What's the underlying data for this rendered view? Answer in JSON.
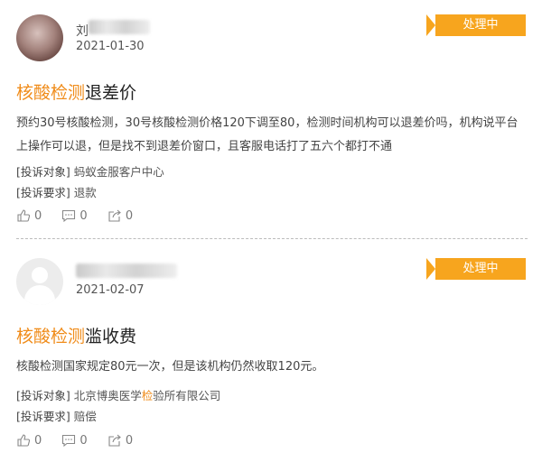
{
  "complaints": [
    {
      "username": "刘",
      "date": "2021-01-30",
      "status": "处理中",
      "title_highlight": "核酸检测",
      "title_rest": "退差价",
      "description": "预约30号核酸检测，30号核酸检测价格120下调至80，检测时间机构可以退差价吗，机构说平台上操作可以退，但是找不到退差价窗口，且客服电话打了五六个都打不通",
      "target_label": "[投诉对象]",
      "target_value": "蚂蚁金服客户中心",
      "request_label": "[投诉要求]",
      "request_value": "退款",
      "likes": "0",
      "comments": "0",
      "shares": "0"
    },
    {
      "username": "",
      "date": "2021-02-07",
      "status": "处理中",
      "title_highlight": "核酸检测",
      "title_rest": "滥收费",
      "description": "核酸检测国家规定80元一次，但是该机构仍然收取120元。",
      "target_label": "[投诉对象]",
      "target_value_pre": "北京博奥医学",
      "target_value_hl": "检",
      "target_value_post": "验所有限公司",
      "request_label": "[投诉要求]",
      "request_value": "赔偿",
      "likes": "0",
      "comments": "0",
      "shares": "0"
    }
  ],
  "icons": {
    "like": "thumbs-up-icon",
    "comment": "comment-icon",
    "share": "share-icon"
  },
  "colors": {
    "accent": "#f08c1a",
    "badge": "#f7a51e"
  }
}
